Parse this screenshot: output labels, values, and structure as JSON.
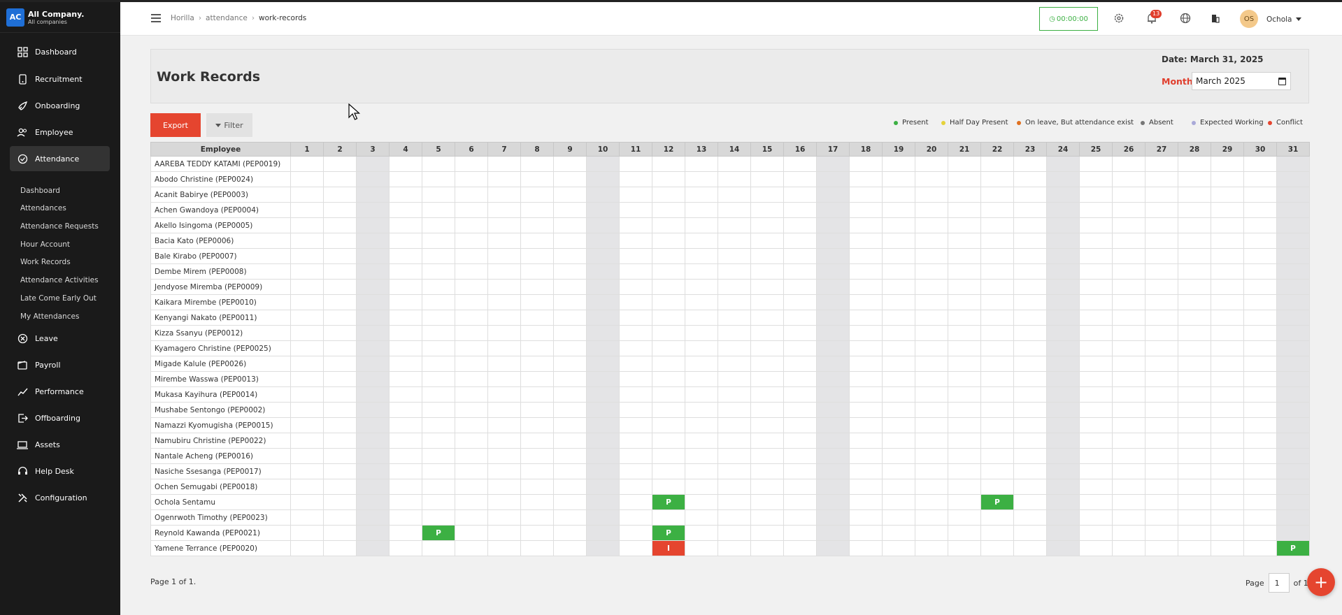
{
  "brand": {
    "logo": "AC",
    "name": "All Company.",
    "sub": "All companies"
  },
  "sidebar": {
    "items": [
      {
        "label": "Dashboard",
        "icon": "dashboard-icon"
      },
      {
        "label": "Recruitment",
        "icon": "recruitment-icon"
      },
      {
        "label": "Onboarding",
        "icon": "rocket-icon"
      },
      {
        "label": "Employee",
        "icon": "people-icon"
      },
      {
        "label": "Attendance",
        "icon": "check-circle-icon"
      },
      {
        "label": "Leave",
        "icon": "x-circle-icon"
      },
      {
        "label": "Payroll",
        "icon": "wallet-icon"
      },
      {
        "label": "Performance",
        "icon": "trend-icon"
      },
      {
        "label": "Offboarding",
        "icon": "exit-icon"
      },
      {
        "label": "Assets",
        "icon": "laptop-icon"
      },
      {
        "label": "Help Desk",
        "icon": "headset-icon"
      },
      {
        "label": "Configuration",
        "icon": "tools-icon"
      }
    ],
    "sub_items": [
      "Dashboard",
      "Attendances",
      "Attendance Requests",
      "Hour Account",
      "Work Records",
      "Attendance Activities",
      "Late Come Early Out",
      "My Attendances"
    ]
  },
  "header": {
    "breadcrumb": [
      "Horilla",
      "attendance",
      "work-records"
    ],
    "timer": "00:00:00",
    "notif_count": "13",
    "avatar": "OS",
    "user_name": "Ochola"
  },
  "title_panel": {
    "title": "Work Records",
    "date": "Date: March 31, 2025",
    "month_label": "Month",
    "month_value": "March 2025"
  },
  "toolbar": {
    "export": "Export",
    "filter": "Filter"
  },
  "legend": [
    {
      "label": "Present",
      "color": "#3cb043"
    },
    {
      "label": "Half Day Present",
      "color": "#e5d23a"
    },
    {
      "label": "On leave, But attendance exist",
      "color": "#e0701f"
    },
    {
      "label": "Absent",
      "color": "#777777"
    },
    {
      "label": "Expected Working",
      "color": "#a9a9d8"
    },
    {
      "label": "Conflict",
      "color": "#e5452f"
    }
  ],
  "table": {
    "header": "Employee",
    "days": [
      "1",
      "2",
      "3",
      "4",
      "5",
      "6",
      "7",
      "8",
      "9",
      "10",
      "11",
      "12",
      "13",
      "14",
      "15",
      "16",
      "17",
      "18",
      "19",
      "20",
      "21",
      "22",
      "23",
      "24",
      "25",
      "26",
      "27",
      "28",
      "29",
      "30",
      "31"
    ],
    "weekend_days": [
      3,
      10,
      17,
      24,
      31
    ],
    "employees": [
      "AAREBA TEDDY KATAMI (PEP0019)",
      "Abodo Christine (PEP0024)",
      "Acanit Babirye (PEP0003)",
      "Achen Gwandoya (PEP0004)",
      "Akello Isingoma (PEP0005)",
      "Bacia Kato (PEP0006)",
      "Bale Kirabo (PEP0007)",
      "Dembe Mirem (PEP0008)",
      "Jendyose Miremba (PEP0009)",
      "Kaikara Mirembe (PEP0010)",
      "Kenyangi Nakato (PEP0011)",
      "Kizza Ssanyu (PEP0012)",
      "Kyamagero Christine (PEP0025)",
      "Migade Kalule (PEP0026)",
      "Mirembe Wasswa (PEP0013)",
      "Mukasa Kayihura (PEP0014)",
      "Mushabe Sentongo (PEP0002)",
      "Namazzi Kyomugisha (PEP0015)",
      "Namubiru Christine (PEP0022)",
      "Nantale Acheng (PEP0016)",
      "Nasiche Ssesanga (PEP0017)",
      "Ochen Semugabi (PEP0018)",
      "Ochola Sentamu",
      "Ogenrwoth Timothy (PEP0023)",
      "Reynold Kawanda (PEP0021)",
      "Yamene Terrance (PEP0020)"
    ],
    "marks": [
      {
        "row": 22,
        "day": 12,
        "text": "P",
        "kind": "present"
      },
      {
        "row": 22,
        "day": 22,
        "text": "P",
        "kind": "present"
      },
      {
        "row": 24,
        "day": 5,
        "text": "P",
        "kind": "present"
      },
      {
        "row": 24,
        "day": 12,
        "text": "P",
        "kind": "present"
      },
      {
        "row": 25,
        "day": 12,
        "text": "I",
        "kind": "conflict"
      },
      {
        "row": 25,
        "day": 31,
        "text": "P",
        "kind": "present"
      }
    ]
  },
  "footer": {
    "page_info": "Page 1 of 1.",
    "page_label": "Page",
    "page_value": "1",
    "of_label": "of 1"
  }
}
